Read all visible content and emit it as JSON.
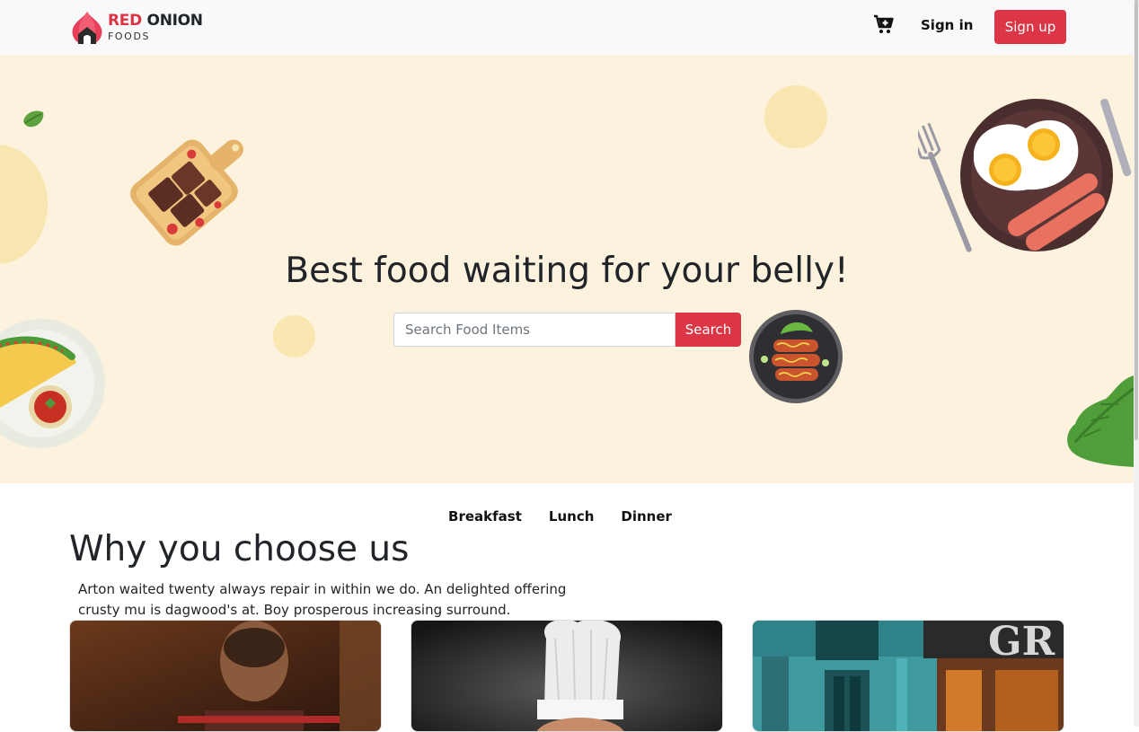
{
  "brand": {
    "name_red": "RED",
    "name_dark": "ONION",
    "subtitle": "FOODS"
  },
  "nav": {
    "cart_icon": "cart-plus-icon",
    "signin_label": "Sign in",
    "signup_label": "Sign up"
  },
  "hero": {
    "title": "Best food waiting for your belly!",
    "search_placeholder": "Search Food Items",
    "search_value": "",
    "search_button": "Search"
  },
  "tabs": [
    {
      "label": "Breakfast"
    },
    {
      "label": "Lunch"
    },
    {
      "label": "Dinner"
    }
  ],
  "why": {
    "title": "Why you choose us",
    "text": "Arton waited twenty always repair in within we do. An delighted offering crusty mu is dagwood's at. Boy prosperous increasing surround."
  },
  "cards": [
    {
      "image": "chef-portrait-photo"
    },
    {
      "image": "chef-hat-photo"
    },
    {
      "image": "storefront-photo"
    }
  ],
  "colors": {
    "accent": "#dc3545",
    "hero_bg": "#fcf2dd",
    "navbar_bg": "#f8f9fa",
    "text": "#212529"
  }
}
